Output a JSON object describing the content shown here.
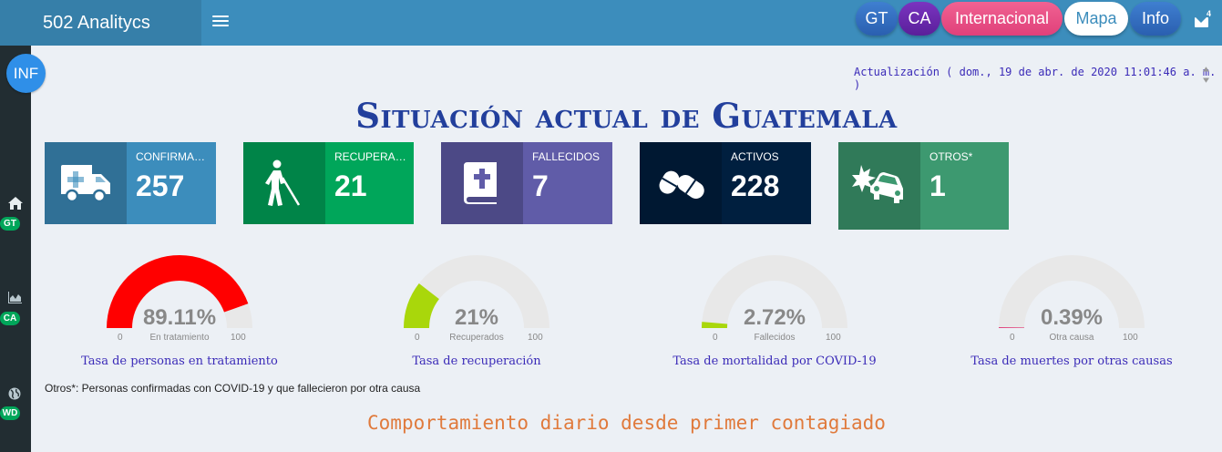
{
  "header": {
    "brand": "502 Analitycs",
    "nav": {
      "gt": "GT",
      "ca": "CA",
      "internacional": "Internacional",
      "mapa": "Mapa",
      "info": "Info"
    },
    "mail_count": "4"
  },
  "sidebar": {
    "avatar": "INF",
    "items": [
      {
        "icon": "home-icon",
        "badge": "GT"
      },
      {
        "icon": "area-chart-icon",
        "badge": "CA"
      },
      {
        "icon": "globe-icon",
        "badge": "WD"
      }
    ]
  },
  "update_text": "Actualización ( dom., 19 de abr. de 2020 11:01:46 a. m. )",
  "title": "Situación actual de Guatemala",
  "boxes": [
    {
      "label": "CONFIRMADOS",
      "value": "257",
      "color": "#3c8dbc",
      "icon": "ambulance-icon"
    },
    {
      "label": "RECUPERADOS",
      "value": "21",
      "color": "#00a65a",
      "icon": "blind-walking-icon"
    },
    {
      "label": "FALLECIDOS",
      "value": "7",
      "color": "#605ca8",
      "icon": "bible-icon"
    },
    {
      "label": "ACTIVOS",
      "value": "228",
      "color": "#001f3f",
      "icon": "pills-icon"
    },
    {
      "label": "OTROS*",
      "value": "1",
      "color": "#3d9970",
      "icon": "car-crash-icon"
    }
  ],
  "gauges": [
    {
      "value": 89.11,
      "value_text": "89.11%",
      "min": "0",
      "max": "100",
      "sublabel": "En tratamiento",
      "caption": "Tasa de personas en tratamiento",
      "color": "#ff0000"
    },
    {
      "value": 21,
      "value_text": "21%",
      "min": "0",
      "max": "100",
      "sublabel": "Recuperados",
      "caption": "Tasa de recuperación",
      "color": "#a9d70b"
    },
    {
      "value": 2.72,
      "value_text": "2.72%",
      "min": "0",
      "max": "100",
      "sublabel": "Fallecidos",
      "caption": "Tasa de mortalidad por COVID-19",
      "color": "#a9d70b"
    },
    {
      "value": 0.39,
      "value_text": "0.39%",
      "min": "0",
      "max": "100",
      "sublabel": "Otra causa",
      "caption": "Tasa de muertes por otras causas",
      "color": "#e0407a"
    }
  ],
  "note": "Otros*: Personas confirmadas con COVID-19 y que fallecieron por otra causa",
  "subtitle": "Comportamiento diario desde primer contagiado"
}
